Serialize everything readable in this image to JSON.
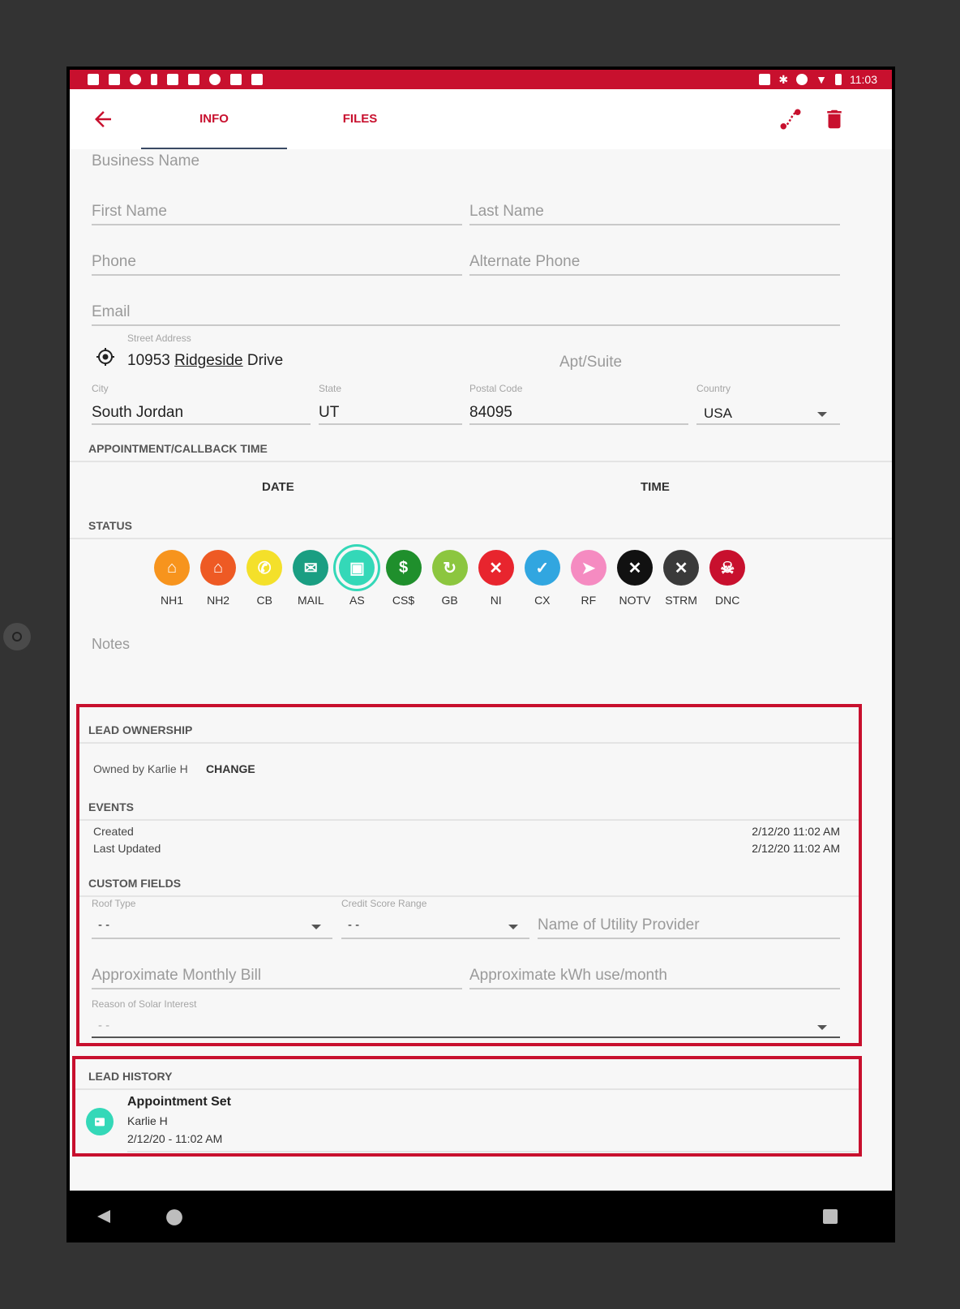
{
  "status_bar": {
    "time": "11:03"
  },
  "tabs": [
    {
      "label": "INFO"
    },
    {
      "label": "FILES"
    }
  ],
  "form": {
    "business_name": "Business Name",
    "first_name": "First Name",
    "last_name": "Last Name",
    "phone": "Phone",
    "alternate_phone": "Alternate Phone",
    "email": "Email",
    "street_label": "Street Address",
    "street_value_num": "10953",
    "street_value_name": "Ridgeside",
    "street_value_suffix": "Drive",
    "apt": "Apt/Suite",
    "city_label": "City",
    "city_value": "South Jordan",
    "state_label": "State",
    "state_value": "UT",
    "postal_label": "Postal Code",
    "postal_value": "84095",
    "country_label": "Country",
    "country_value": "USA"
  },
  "appointment": {
    "title": "APPOINTMENT/CALLBACK TIME",
    "date": "DATE",
    "time": "TIME"
  },
  "status": {
    "title": "STATUS",
    "items": [
      {
        "label": "NH1",
        "color": "#f7941d",
        "icon": "home-icon"
      },
      {
        "label": "NH2",
        "color": "#ee5a24",
        "icon": "home-icon"
      },
      {
        "label": "CB",
        "color": "#f4e02a",
        "icon": "phone-icon"
      },
      {
        "label": "MAIL",
        "color": "#1a9e82",
        "icon": "mail-icon"
      },
      {
        "label": "AS",
        "color": "#34d8b8",
        "icon": "calendar-icon"
      },
      {
        "label": "CS$",
        "color": "#1f8f2c",
        "icon": "dollar-icon"
      },
      {
        "label": "GB",
        "color": "#8cc63f",
        "icon": "refresh-icon"
      },
      {
        "label": "NI",
        "color": "#e8252e",
        "icon": "x-icon"
      },
      {
        "label": "CX",
        "color": "#31a6e0",
        "icon": "check-icon"
      },
      {
        "label": "RF",
        "color": "#f58bc1",
        "icon": "send-icon"
      },
      {
        "label": "NOTV",
        "color": "#111111",
        "icon": "x-icon"
      },
      {
        "label": "STRM",
        "color": "#3a3a3a",
        "icon": "x-icon"
      },
      {
        "label": "DNC",
        "color": "#c8102e",
        "icon": "skull-icon"
      }
    ]
  },
  "notes": "Notes",
  "ownership": {
    "title": "LEAD OWNERSHIP",
    "owned_by": "Owned by Karlie H",
    "change": "CHANGE"
  },
  "events": {
    "title": "EVENTS",
    "rows": [
      {
        "label": "Created",
        "value": "2/12/20 11:02 AM"
      },
      {
        "label": "Last Updated",
        "value": "2/12/20 11:02 AM"
      }
    ]
  },
  "custom_fields": {
    "title": "CUSTOM FIELDS",
    "roof_label": "Roof Type",
    "roof_value": "- -",
    "credit_label": "Credit Score Range",
    "credit_value": "- -",
    "utility": "Name of Utility Provider",
    "bill": "Approximate Monthly Bill",
    "kwh": "Approximate kWh use/month",
    "reason_label": "Reason of Solar Interest",
    "reason_value": "- -"
  },
  "history": {
    "title": "LEAD HISTORY",
    "event": "Appointment Set",
    "user": "Karlie H",
    "when": "2/12/20 - 11:02 AM"
  },
  "colors": {
    "brand": "#c8102e",
    "accent": "#34d8b8"
  }
}
